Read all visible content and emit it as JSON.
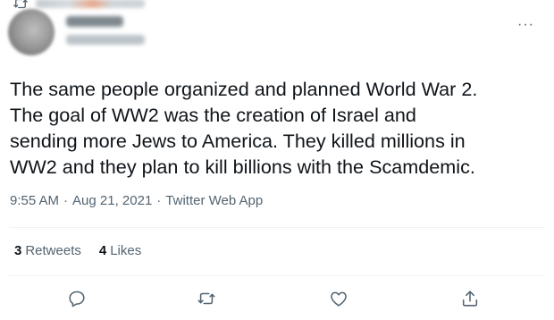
{
  "tweet": {
    "text_lines": [
      "The same people organized and planned World War 2.",
      "The goal of WW2 was the creation of Israel and",
      "sending more Jews to America. They killed millions in",
      "WW2 and they plan to kill billions with the Scamdemic."
    ],
    "time": "9:55 AM",
    "date": "Aug 21, 2021",
    "separator": "·",
    "source": "Twitter Web App",
    "more_label": "···"
  },
  "stats": {
    "retweets_count": "3",
    "retweets_label": "Retweets",
    "likes_count": "4",
    "likes_label": "Likes"
  },
  "icons": {
    "retweet_header": "retweet-icon",
    "reply": "reply-icon",
    "retweet": "retweet-icon",
    "like": "heart-icon",
    "share": "share-icon"
  },
  "colors": {
    "text": "#0f1419",
    "secondary": "#536471",
    "divider": "#eff3f4"
  }
}
